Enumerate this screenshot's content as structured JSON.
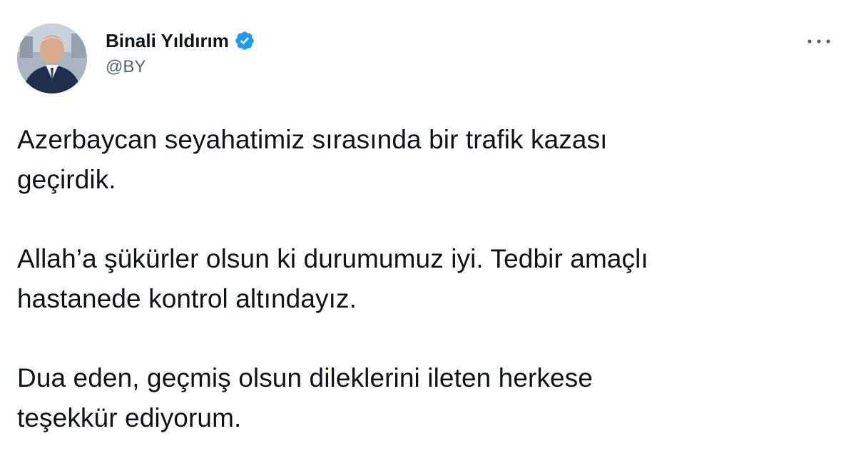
{
  "author": {
    "display_name": "Binali Yıldırım",
    "handle": "@BY",
    "verified": true,
    "avatar_icon": "profile-photo"
  },
  "menu": {
    "icon": "more-horizontal-icon"
  },
  "tweet": {
    "paragraphs": [
      "Azerbaycan seyahatimiz sırasında bir trafik kazası\ngeçirdik.",
      "Allah’a şükürler olsun ki durumumuz iyi. Tedbir amaçlı\nhastanede kontrol altındayız.",
      "Dua eden, geçmiş olsun dileklerini ileten herkese\nteşekkür ediyorum."
    ]
  },
  "colors": {
    "verified_blue": "#1d9bf0",
    "text_primary": "#0f1419",
    "text_secondary": "#536471"
  }
}
